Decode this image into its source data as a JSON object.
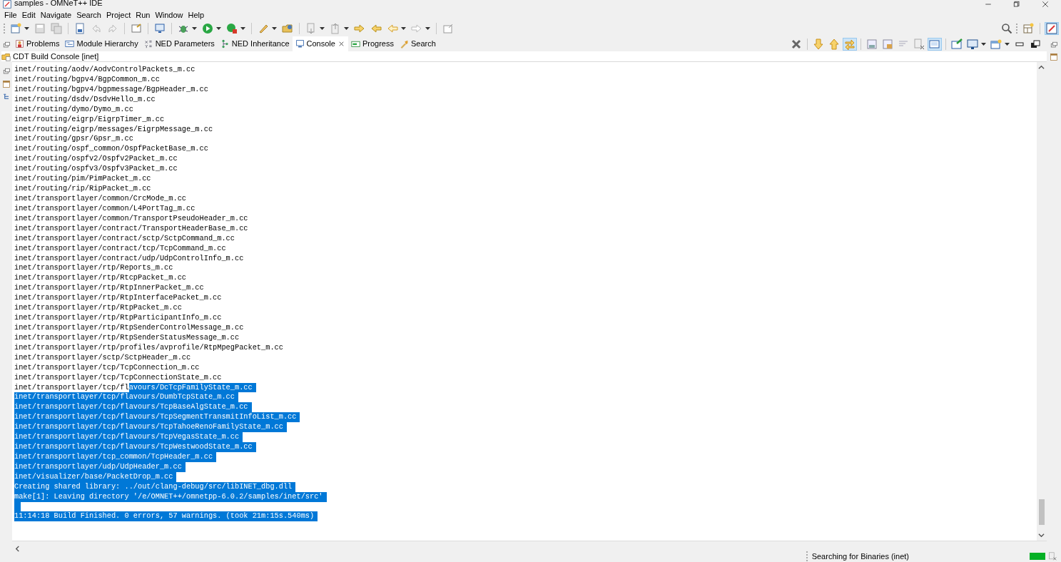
{
  "window": {
    "title": "samples - OMNeT++ IDE"
  },
  "menu": [
    "File",
    "Edit",
    "Navigate",
    "Search",
    "Project",
    "Run",
    "Window",
    "Help"
  ],
  "tabs": [
    {
      "label": "Problems",
      "selected": false
    },
    {
      "label": "Module Hierarchy",
      "selected": false
    },
    {
      "label": "NED Parameters",
      "selected": false
    },
    {
      "label": "NED Inheritance",
      "selected": false
    },
    {
      "label": "Console",
      "selected": true
    },
    {
      "label": "Progress",
      "selected": false
    },
    {
      "label": "Search",
      "selected": false
    }
  ],
  "console": {
    "title": "CDT Build Console [inet]",
    "lines": [
      {
        "kind": "text",
        "text": "inet/routing/aodv/AodvControlPackets_m.cc",
        "selected": false
      },
      {
        "kind": "text",
        "text": "inet/routing/bgpv4/BgpCommon_m.cc",
        "selected": false
      },
      {
        "kind": "text",
        "text": "inet/routing/bgpv4/bgpmessage/BgpHeader_m.cc",
        "selected": false
      },
      {
        "kind": "text",
        "text": "inet/routing/dsdv/DsdvHello_m.cc",
        "selected": false
      },
      {
        "kind": "text",
        "text": "inet/routing/dymo/Dymo_m.cc",
        "selected": false
      },
      {
        "kind": "text",
        "text": "inet/routing/eigrp/EigrpTimer_m.cc",
        "selected": false
      },
      {
        "kind": "text",
        "text": "inet/routing/eigrp/messages/EigrpMessage_m.cc",
        "selected": false
      },
      {
        "kind": "text",
        "text": "inet/routing/gpsr/Gpsr_m.cc",
        "selected": false
      },
      {
        "kind": "text",
        "text": "inet/routing/ospf_common/OspfPacketBase_m.cc",
        "selected": false
      },
      {
        "kind": "text",
        "text": "inet/routing/ospfv2/Ospfv2Packet_m.cc",
        "selected": false
      },
      {
        "kind": "text",
        "text": "inet/routing/ospfv3/Ospfv3Packet_m.cc",
        "selected": false
      },
      {
        "kind": "text",
        "text": "inet/routing/pim/PimPacket_m.cc",
        "selected": false
      },
      {
        "kind": "text",
        "text": "inet/routing/rip/RipPacket_m.cc",
        "selected": false
      },
      {
        "kind": "text",
        "text": "inet/transportlayer/common/CrcMode_m.cc",
        "selected": false
      },
      {
        "kind": "text",
        "text": "inet/transportlayer/common/L4PortTag_m.cc",
        "selected": false
      },
      {
        "kind": "text",
        "text": "inet/transportlayer/common/TransportPseudoHeader_m.cc",
        "selected": false
      },
      {
        "kind": "text",
        "text": "inet/transportlayer/contract/TransportHeaderBase_m.cc",
        "selected": false
      },
      {
        "kind": "text",
        "text": "inet/transportlayer/contract/sctp/SctpCommand_m.cc",
        "selected": false
      },
      {
        "kind": "text",
        "text": "inet/transportlayer/contract/tcp/TcpCommand_m.cc",
        "selected": false
      },
      {
        "kind": "text",
        "text": "inet/transportlayer/contract/udp/UdpControlInfo_m.cc",
        "selected": false
      },
      {
        "kind": "text",
        "text": "inet/transportlayer/rtp/Reports_m.cc",
        "selected": false
      },
      {
        "kind": "text",
        "text": "inet/transportlayer/rtp/RtcpPacket_m.cc",
        "selected": false
      },
      {
        "kind": "text",
        "text": "inet/transportlayer/rtp/RtpInnerPacket_m.cc",
        "selected": false
      },
      {
        "kind": "text",
        "text": "inet/transportlayer/rtp/RtpInterfacePacket_m.cc",
        "selected": false
      },
      {
        "kind": "text",
        "text": "inet/transportlayer/rtp/RtpPacket_m.cc",
        "selected": false
      },
      {
        "kind": "text",
        "text": "inet/transportlayer/rtp/RtpParticipantInfo_m.cc",
        "selected": false
      },
      {
        "kind": "text",
        "text": "inet/transportlayer/rtp/RtpSenderControlMessage_m.cc",
        "selected": false
      },
      {
        "kind": "text",
        "text": "inet/transportlayer/rtp/RtpSenderStatusMessage_m.cc",
        "selected": false
      },
      {
        "kind": "text",
        "text": "inet/transportlayer/rtp/profiles/avprofile/RtpMpegPacket_m.cc",
        "selected": false
      },
      {
        "kind": "text",
        "text": "inet/transportlayer/sctp/SctpHeader_m.cc",
        "selected": false
      },
      {
        "kind": "text",
        "text": "inet/transportlayer/tcp/TcpConnection_m.cc",
        "selected": false
      },
      {
        "kind": "text",
        "text": "inet/transportlayer/tcp/TcpConnectionState_m.cc",
        "selected": false
      },
      {
        "kind": "split",
        "parts": [
          {
            "text": "inet/transportlayer/tcp/fl",
            "selected": false
          },
          {
            "text": "avours/DcTcpFamilyState_m.cc",
            "selected": true
          }
        ]
      },
      {
        "kind": "text",
        "text": "inet/transportlayer/tcp/flavours/DumbTcpState_m.cc",
        "selected": true
      },
      {
        "kind": "text",
        "text": "inet/transportlayer/tcp/flavours/TcpBaseAlgState_m.cc",
        "selected": true
      },
      {
        "kind": "text",
        "text": "inet/transportlayer/tcp/flavours/TcpSegmentTransmitInfoList_m.cc",
        "selected": true
      },
      {
        "kind": "text",
        "text": "inet/transportlayer/tcp/flavours/TcpTahoeRenoFamilyState_m.cc",
        "selected": true
      },
      {
        "kind": "text",
        "text": "inet/transportlayer/tcp/flavours/TcpVegasState_m.cc",
        "selected": true
      },
      {
        "kind": "text",
        "text": "inet/transportlayer/tcp/flavours/TcpWestwoodState_m.cc",
        "selected": true
      },
      {
        "kind": "text",
        "text": "inet/transportlayer/tcp_common/TcpHeader_m.cc",
        "selected": true
      },
      {
        "kind": "text",
        "text": "inet/transportlayer/udp/UdpHeader_m.cc",
        "selected": true
      },
      {
        "kind": "text",
        "text": "inet/visualizer/base/PacketDrop_m.cc",
        "selected": true
      },
      {
        "kind": "text",
        "text": "Creating shared library: ../out/clang-debug/src/libINET_dbg.dll",
        "selected": true
      },
      {
        "kind": "text",
        "text": "make[1]: Leaving directory '/e/OMNET++/omnetpp-6.0.2/samples/inet/src'",
        "selected": true
      },
      {
        "kind": "blank",
        "selected": true
      },
      {
        "kind": "text",
        "text": "11:14:18 Build Finished. 0 errors, 57 warnings. (took 21m:15s.540ms)",
        "selected": true
      }
    ]
  },
  "status_bar": {
    "text": "Searching for Binaries (inet)",
    "progress": {
      "level": 1
    }
  }
}
